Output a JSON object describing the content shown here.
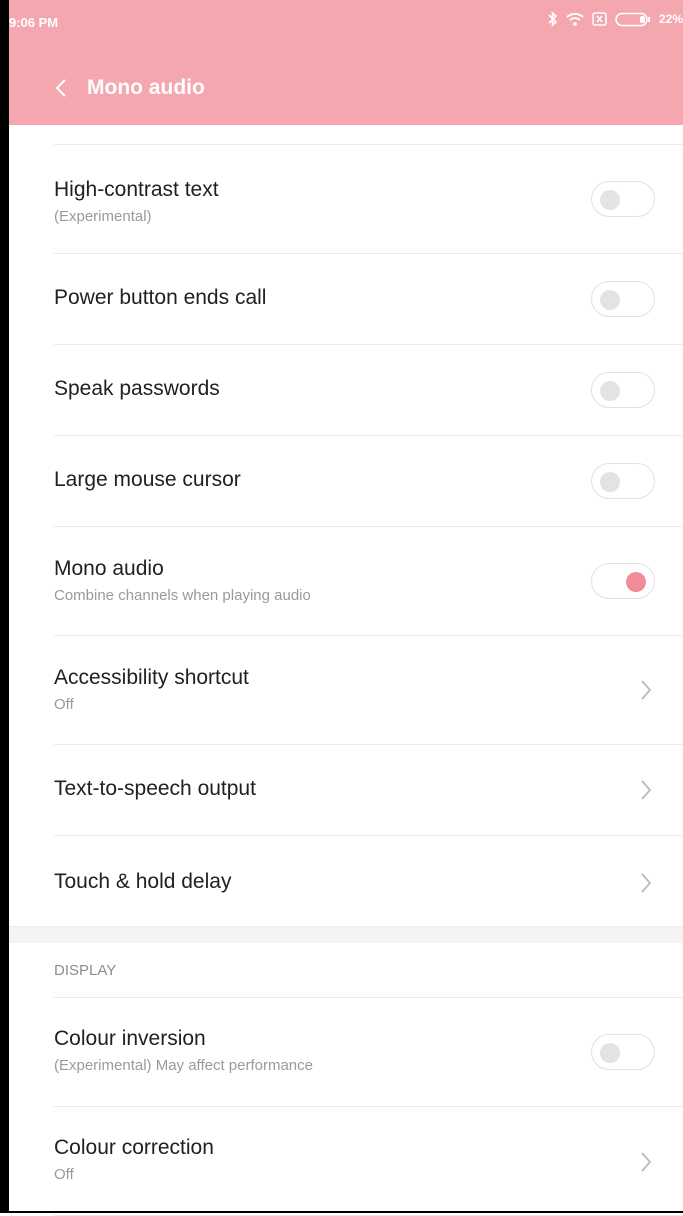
{
  "status_bar": {
    "time": "9:06 PM",
    "icons": [
      "bluetooth-icon",
      "wifi-icon",
      "sim-icon",
      "battery-icon"
    ],
    "battery": "22%"
  },
  "appbar": {
    "title": "Mono audio",
    "back_icon": "back-chevron-icon"
  },
  "colors": {
    "header_bg": "#f5a7af",
    "toggle_on": "#f28c99",
    "toggle_off": "#e3e3e3"
  },
  "settings": [
    {
      "title": "High-contrast text",
      "subtitle": "(Experimental)",
      "control": "toggle",
      "on": false
    },
    {
      "title": "Power button ends call",
      "subtitle": "",
      "control": "toggle",
      "on": false
    },
    {
      "title": "Speak passwords",
      "subtitle": "",
      "control": "toggle",
      "on": false
    },
    {
      "title": "Large mouse cursor",
      "subtitle": "",
      "control": "toggle",
      "on": false
    },
    {
      "title": "Mono audio",
      "subtitle": "Combine channels when playing audio",
      "control": "toggle",
      "on": true
    },
    {
      "title": "Accessibility shortcut",
      "subtitle": "Off",
      "control": "chevron"
    },
    {
      "title": "Text-to-speech output",
      "subtitle": "",
      "control": "chevron"
    },
    {
      "title": "Touch & hold delay",
      "subtitle": "",
      "control": "chevron"
    }
  ],
  "display_section": {
    "header": "DISPLAY",
    "items": [
      {
        "title": "Colour inversion",
        "subtitle": "(Experimental) May affect performance",
        "control": "toggle",
        "on": false
      },
      {
        "title": "Colour correction",
        "subtitle": "Off",
        "control": "chevron"
      }
    ]
  }
}
